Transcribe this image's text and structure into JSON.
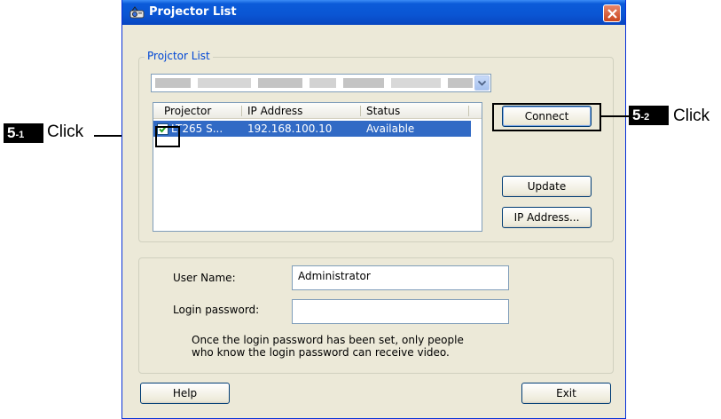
{
  "window": {
    "title": "Projector List"
  },
  "projector_group": {
    "legend": "Projctor List",
    "columns": [
      "Projector",
      "IP Address",
      "Status"
    ],
    "rows": [
      {
        "checked": true,
        "projector": "LT265 S...",
        "ip": "192.168.100.10",
        "status": "Available"
      }
    ]
  },
  "buttons": {
    "connect": "Connect",
    "update": "Update",
    "ip_address": "IP Address...",
    "help": "Help",
    "exit": "Exit"
  },
  "login": {
    "user_label": "User Name:",
    "user_value": "Administrator",
    "password_label": "Login password:",
    "password_value": "",
    "note_line1": "Once the login password has been set, only people",
    "note_line2": "who know the login password can receive video."
  },
  "annotations": {
    "badge_1_num": "5",
    "badge_1_sub": "-1",
    "badge_2_num": "5",
    "badge_2_sub": "-2",
    "click_1": "Click",
    "click_2": "Click"
  },
  "colors": {
    "titlebar": "#0a55d3",
    "selection": "#316ac5",
    "legend_text": "#0046d5",
    "window_bg": "#ece9d8"
  }
}
